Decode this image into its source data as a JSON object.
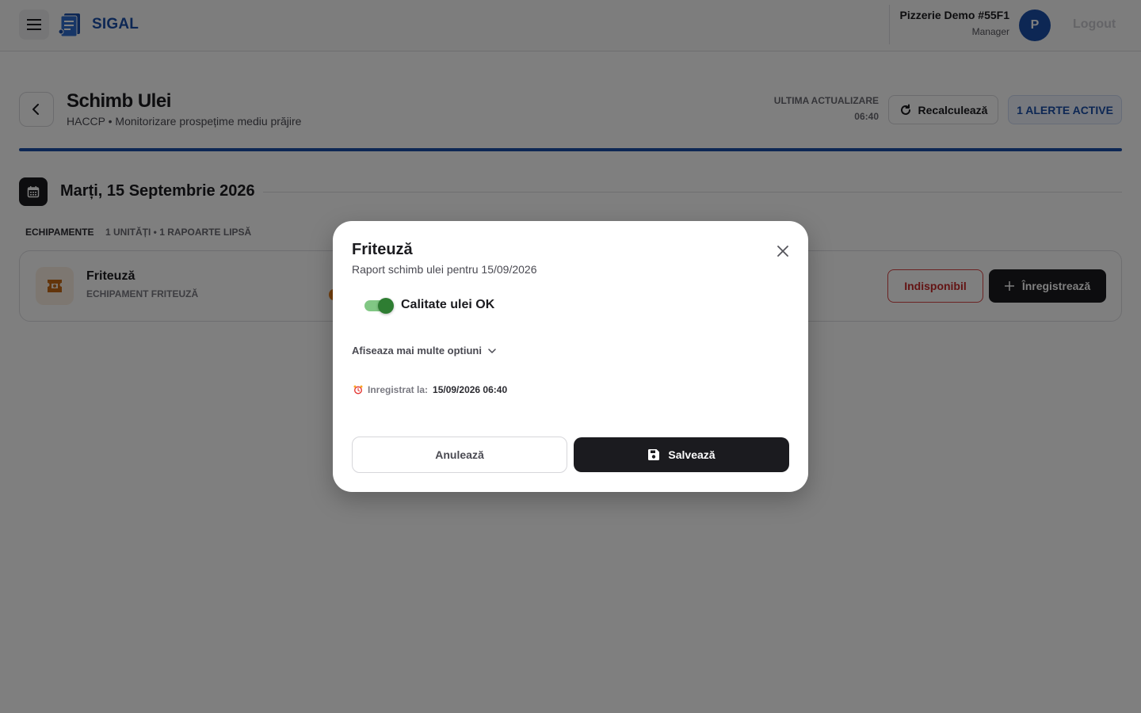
{
  "app": {
    "brand": "SIGAL"
  },
  "header": {
    "store_name": "Pizzerie Demo #55F1",
    "store_role": "Manager",
    "avatar_initial": "P",
    "logout_label": "Logout"
  },
  "page": {
    "title": "Schimb Ulei",
    "subtitle": "HACCP • Monitorizare prospețime mediu prăjire",
    "last_update_label": "ULTIMA ACTUALIZARE",
    "last_update_time": "06:40",
    "recalc_label": "Recalculează",
    "alerts_label": "1 ALERTE ACTIVE"
  },
  "date_section": {
    "title": "Marți, 15 Septembrie 2026",
    "section_label": "ECHIPAMENTE",
    "section_meta": "1 UNITĂȚI • 1 RAPOARTE LIPSĂ"
  },
  "equipment": [
    {
      "name": "Friteuză",
      "type": "ECHIPAMENT FRITEUZĂ",
      "unavailable_label": "Indisponibil",
      "register_label": "Înregistrează"
    }
  ],
  "modal": {
    "title": "Friteuză",
    "subtitle": "Raport schimb ulei pentru 15/09/2026",
    "toggle_label": "Calitate ulei OK",
    "toggle_on": true,
    "more_options_label": "Afiseaza mai multe optiuni",
    "recorded_label": "Inregistrat la:",
    "recorded_value": "15/09/2026 06:40",
    "cancel_label": "Anulează",
    "save_label": "Salvează"
  },
  "colors": {
    "brand_blue": "#1a4ea8",
    "dark": "#1b1b1f",
    "danger": "#c62828",
    "success": "#2e7d32",
    "equipment_accent": "#e8801c"
  },
  "icons": [
    "menu-icon",
    "document-logo-icon",
    "back-arrow-icon",
    "refresh-icon",
    "calendar-icon",
    "fryer-icon",
    "plus-icon",
    "close-icon",
    "chevron-down-icon",
    "alarm-clock-icon",
    "save-icon"
  ]
}
